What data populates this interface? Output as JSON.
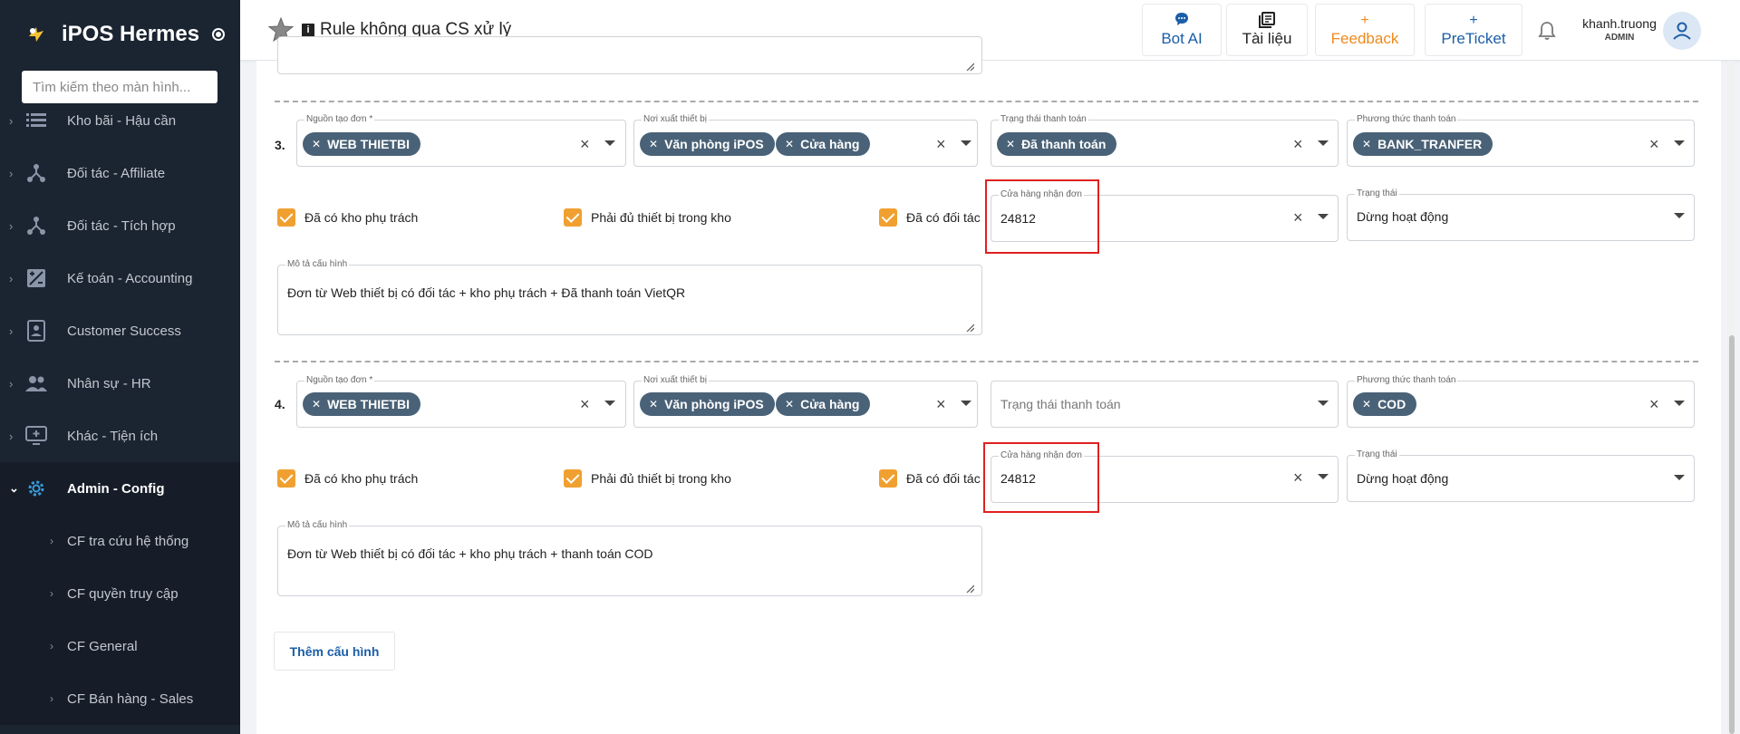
{
  "sidebar": {
    "brand": "iPOS Hermes",
    "search_placeholder": "Tìm kiếm theo màn hình...",
    "items": [
      {
        "label": "Kho bãi - Hậu cần",
        "icon": "warehouse-icon"
      },
      {
        "label": "Đối tác - Affiliate",
        "icon": "network-icon"
      },
      {
        "label": "Đối tác - Tích hợp",
        "icon": "network-icon"
      },
      {
        "label": "Kế toán - Accounting",
        "icon": "calculator-icon"
      },
      {
        "label": "Customer Success",
        "icon": "id-card-icon"
      },
      {
        "label": "Nhân sự - HR",
        "icon": "people-icon"
      },
      {
        "label": "Khác - Tiện ích",
        "icon": "monitor-add-icon"
      },
      {
        "label": "Admin - Config",
        "icon": "gear-icon",
        "active": true
      }
    ],
    "subitems": [
      {
        "label": "CF tra cứu hệ thống"
      },
      {
        "label": "CF quyền truy cập"
      },
      {
        "label": "CF General"
      },
      {
        "label": "CF Bán hàng - Sales"
      }
    ]
  },
  "header": {
    "title": "Rule không qua CS xử lý",
    "buttons": {
      "bot_ai": "Bot AI",
      "docs": "Tài liệu",
      "feedback": "Feedback",
      "preticket": "PreTicket"
    },
    "user": {
      "name": "khanh.truong",
      "role": "ADMIN"
    }
  },
  "rules": [
    {
      "number": "3.",
      "source": {
        "label": "Nguồn tạo đơn *",
        "chips": [
          "WEB THIETBI"
        ]
      },
      "device_origin": {
        "label": "Nơi xuất thiết bị",
        "chips": [
          "Văn phòng iPOS",
          "Cửa hàng"
        ]
      },
      "payment_status": {
        "label": "Trạng thái thanh toán",
        "chips": [
          "Đã thanh toán"
        ],
        "placeholder": ""
      },
      "payment_method": {
        "label": "Phương thức thanh toán",
        "chips": [
          "BANK_TRANFER"
        ]
      },
      "checks": [
        "Đã có kho phụ trách",
        "Phải đủ thiết bị trong kho",
        "Đã có đối tác"
      ],
      "store": {
        "label": "Cửa hàng nhận đơn",
        "value": "24812"
      },
      "status": {
        "label": "Trạng thái",
        "value": "Dừng hoạt động"
      },
      "description": {
        "label": "Mô tả cấu hình",
        "value": "Đơn từ Web thiết bị có đối tác + kho phụ trách + Đã thanh toán VietQR"
      }
    },
    {
      "number": "4.",
      "source": {
        "label": "Nguồn tạo đơn *",
        "chips": [
          "WEB THIETBI"
        ]
      },
      "device_origin": {
        "label": "Nơi xuất thiết bị",
        "chips": [
          "Văn phòng iPOS",
          "Cửa hàng"
        ]
      },
      "payment_status": {
        "label": "",
        "chips": [],
        "placeholder": "Trạng thái thanh toán"
      },
      "payment_method": {
        "label": "Phương thức thanh toán",
        "chips": [
          "COD"
        ]
      },
      "checks": [
        "Đã có kho phụ trách",
        "Phải đủ thiết bị trong kho",
        "Đã có đối tác"
      ],
      "store": {
        "label": "Cửa hàng nhận đơn",
        "value": "24812"
      },
      "status": {
        "label": "Trạng thái",
        "value": "Dừng hoạt động"
      },
      "description": {
        "label": "Mô tả cấu hình",
        "value": "Đơn từ Web thiết bị có đối tác + kho phụ trách + thanh toán COD"
      }
    }
  ],
  "add_button": "Thêm cấu hình",
  "colors": {
    "chip": "#4a6277",
    "checkbox": "#f0a030",
    "highlight": "#e02020",
    "sidebar": "#1b2431",
    "accent": "#1b5ea8"
  }
}
